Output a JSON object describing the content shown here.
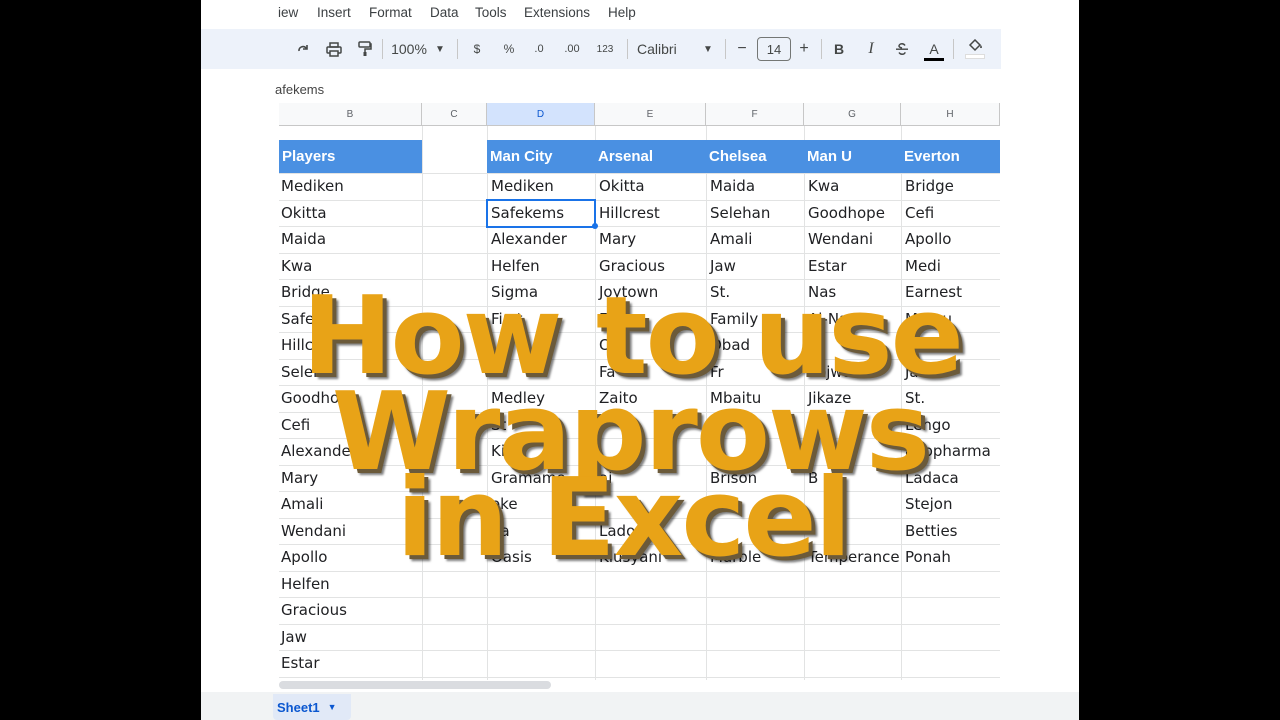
{
  "menu": {
    "items": [
      "iew",
      "Insert",
      "Format",
      "Data",
      "Tools",
      "Extensions",
      "Help"
    ]
  },
  "toolbar": {
    "zoom": "100%",
    "currency": "$",
    "percent": "%",
    "dec_decrease": ".0",
    "dec_increase": ".00",
    "number_format": "123",
    "font": "Calibri",
    "font_size": "14",
    "minus": "−",
    "plus": "+",
    "bold": "B",
    "italic": "I",
    "text_color": "A"
  },
  "formula_bar": {
    "value": "afekems"
  },
  "columns": [
    "B",
    "C",
    "D",
    "E",
    "F",
    "G",
    "H"
  ],
  "headers": {
    "players": "Players",
    "teams": [
      "Man City",
      "Arsenal",
      "Chelsea",
      "Man U",
      "Everton"
    ]
  },
  "players": [
    "Mediken",
    "Okitta",
    "Maida",
    "Kwa",
    "Bridge",
    "Safeke",
    "Hillcre",
    "Seleha",
    "Goodhope",
    "Cefi",
    "Alexander",
    "Mary",
    "Amali",
    "Wendani",
    "Apollo",
    "Helfen",
    "Gracious",
    "Jaw",
    "Estar"
  ],
  "team_rows": [
    [
      "Mediken",
      "Okitta",
      "Maida",
      "Kwa",
      "Bridge"
    ],
    [
      "Safekems",
      "Hillcrest",
      "Selehan",
      "Goodhope",
      "Cefi"
    ],
    [
      "Alexander",
      "Mary",
      "Amali",
      "Wendani",
      "Apollo"
    ],
    [
      "Helfen",
      "Gracious",
      "Jaw",
      "Estar",
      "Medi"
    ],
    [
      "Sigma",
      "Joytown",
      "St.",
      "Nas",
      "Earnest"
    ],
    [
      "First",
      "Fa",
      "Family",
      "Al-Nas",
      "Matuu"
    ],
    [
      "",
      "Ol",
      "Obad",
      "",
      "k"
    ],
    [
      "",
      "Fa",
      "Fr",
      "Kojwa",
      "Ja"
    ],
    [
      "Medley",
      "Zaito",
      "Mbaitu",
      "Jikaze",
      "St."
    ],
    [
      "St",
      "",
      "",
      "",
      "Lengo"
    ],
    [
      "Kia",
      "",
      "",
      "",
      "adopharma"
    ],
    [
      "Gramame",
      "ai",
      "Brison",
      "B",
      "Ladaca"
    ],
    [
      "oke",
      "",
      "",
      "",
      "Stejon"
    ],
    [
      "da",
      "Lado",
      "",
      "",
      "Betties"
    ],
    [
      "Oasis",
      "Klusyani",
      "Marble",
      "Temperance",
      "Ponah"
    ]
  ],
  "sheet": {
    "tab_name": "Sheet1"
  },
  "overlay": {
    "line1": "How to use",
    "line2": "Wraprows",
    "line3": "in Excel"
  },
  "colors": {
    "header_blue": "#4a90e2",
    "overlay_gold": "#e8a317",
    "selection": "#1a73e8"
  }
}
